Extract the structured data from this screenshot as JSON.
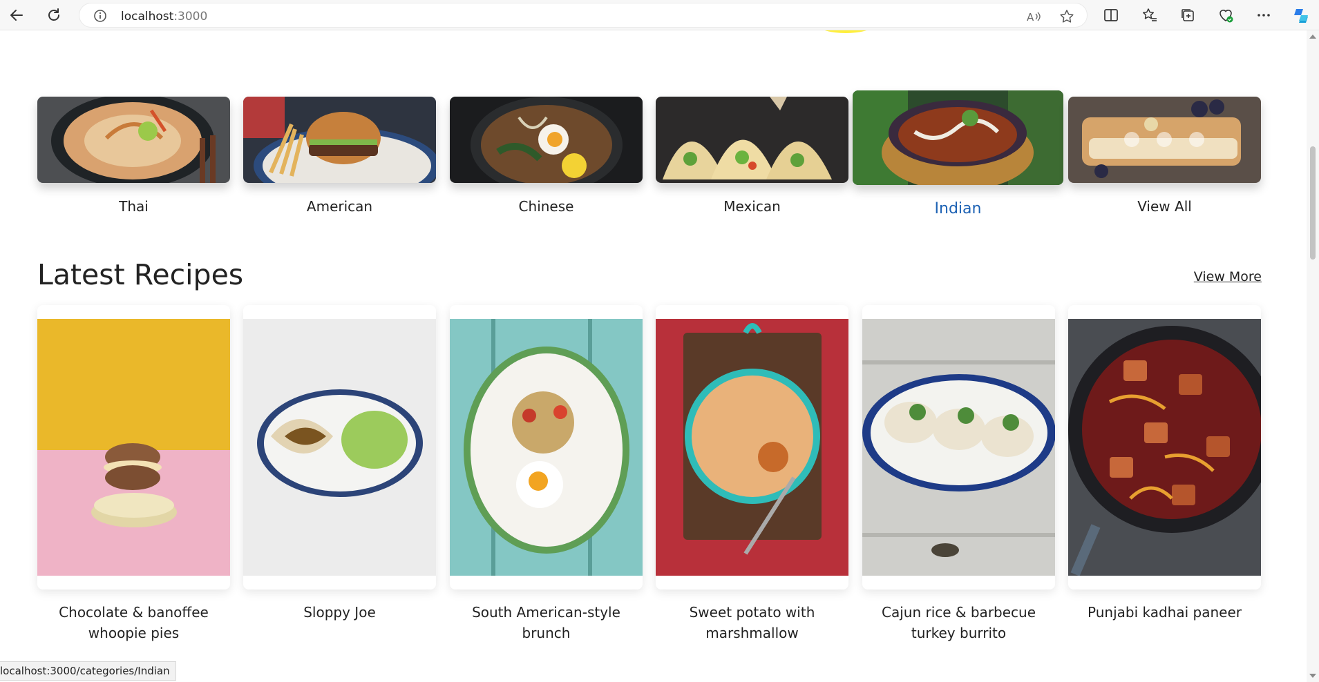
{
  "browser": {
    "url_host": "localhost",
    "url_port": ":3000",
    "status_url": "localhost:3000/categories/Indian"
  },
  "categories": [
    {
      "label": "Thai"
    },
    {
      "label": "American"
    },
    {
      "label": "Chinese"
    },
    {
      "label": "Mexican"
    },
    {
      "label": "Indian",
      "active": true
    },
    {
      "label": "View All"
    }
  ],
  "latest": {
    "title": "Latest Recipes",
    "view_more": "View More",
    "recipes": [
      {
        "line1": "Chocolate & banoffee",
        "line2": "whoopie pies"
      },
      {
        "line1": "Sloppy Joe",
        "line2": ""
      },
      {
        "line1": "South American-style",
        "line2": "brunch"
      },
      {
        "line1": "Sweet potato with",
        "line2": "marshmallow"
      },
      {
        "line1": "Cajun rice & barbecue",
        "line2": "turkey burrito"
      },
      {
        "line1": "Punjabi kadhai paneer",
        "line2": ""
      }
    ]
  },
  "colors": {
    "active_link": "#1d62b4",
    "accent_yellow": "#ffef3c"
  }
}
